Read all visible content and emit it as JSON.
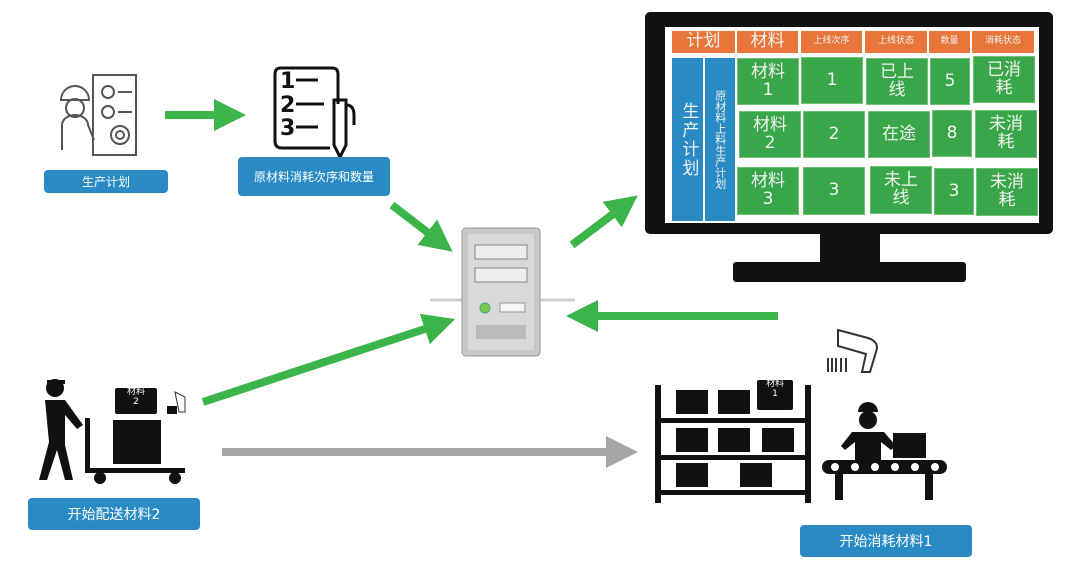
{
  "labels": {
    "production_plan": "生产计划",
    "consumption_order": "原材料消耗次序和数量",
    "start_delivery": "开始配送材料2",
    "start_consume": "开始消耗材料1"
  },
  "cart_tag": "材料\n2",
  "shelf_tag": "材料\n1",
  "list_numbers": [
    "1",
    "2",
    "3"
  ],
  "screen": {
    "headers": [
      "计划",
      "材料",
      "上线次序",
      "上线状态",
      "数量",
      "消耗状态"
    ],
    "side_main": "生产计划",
    "side_sub": "原材料上料生产计划",
    "rows": [
      {
        "material": "材料1",
        "order": "1",
        "status": "已上线",
        "qty": "5",
        "consume": "已消耗"
      },
      {
        "material": "材料2",
        "order": "2",
        "status": "在途",
        "qty": "8",
        "consume": "未消耗"
      },
      {
        "material": "材料3",
        "order": "3",
        "status": "未上线",
        "qty": "3",
        "consume": "未消耗"
      }
    ]
  },
  "colors": {
    "label_blue": "#2a8bc4",
    "arrow_green": "#3bb54a",
    "arrow_grey": "#a6a6a6",
    "header_orange": "#e8763a",
    "cell_green": "#3aa64a"
  }
}
